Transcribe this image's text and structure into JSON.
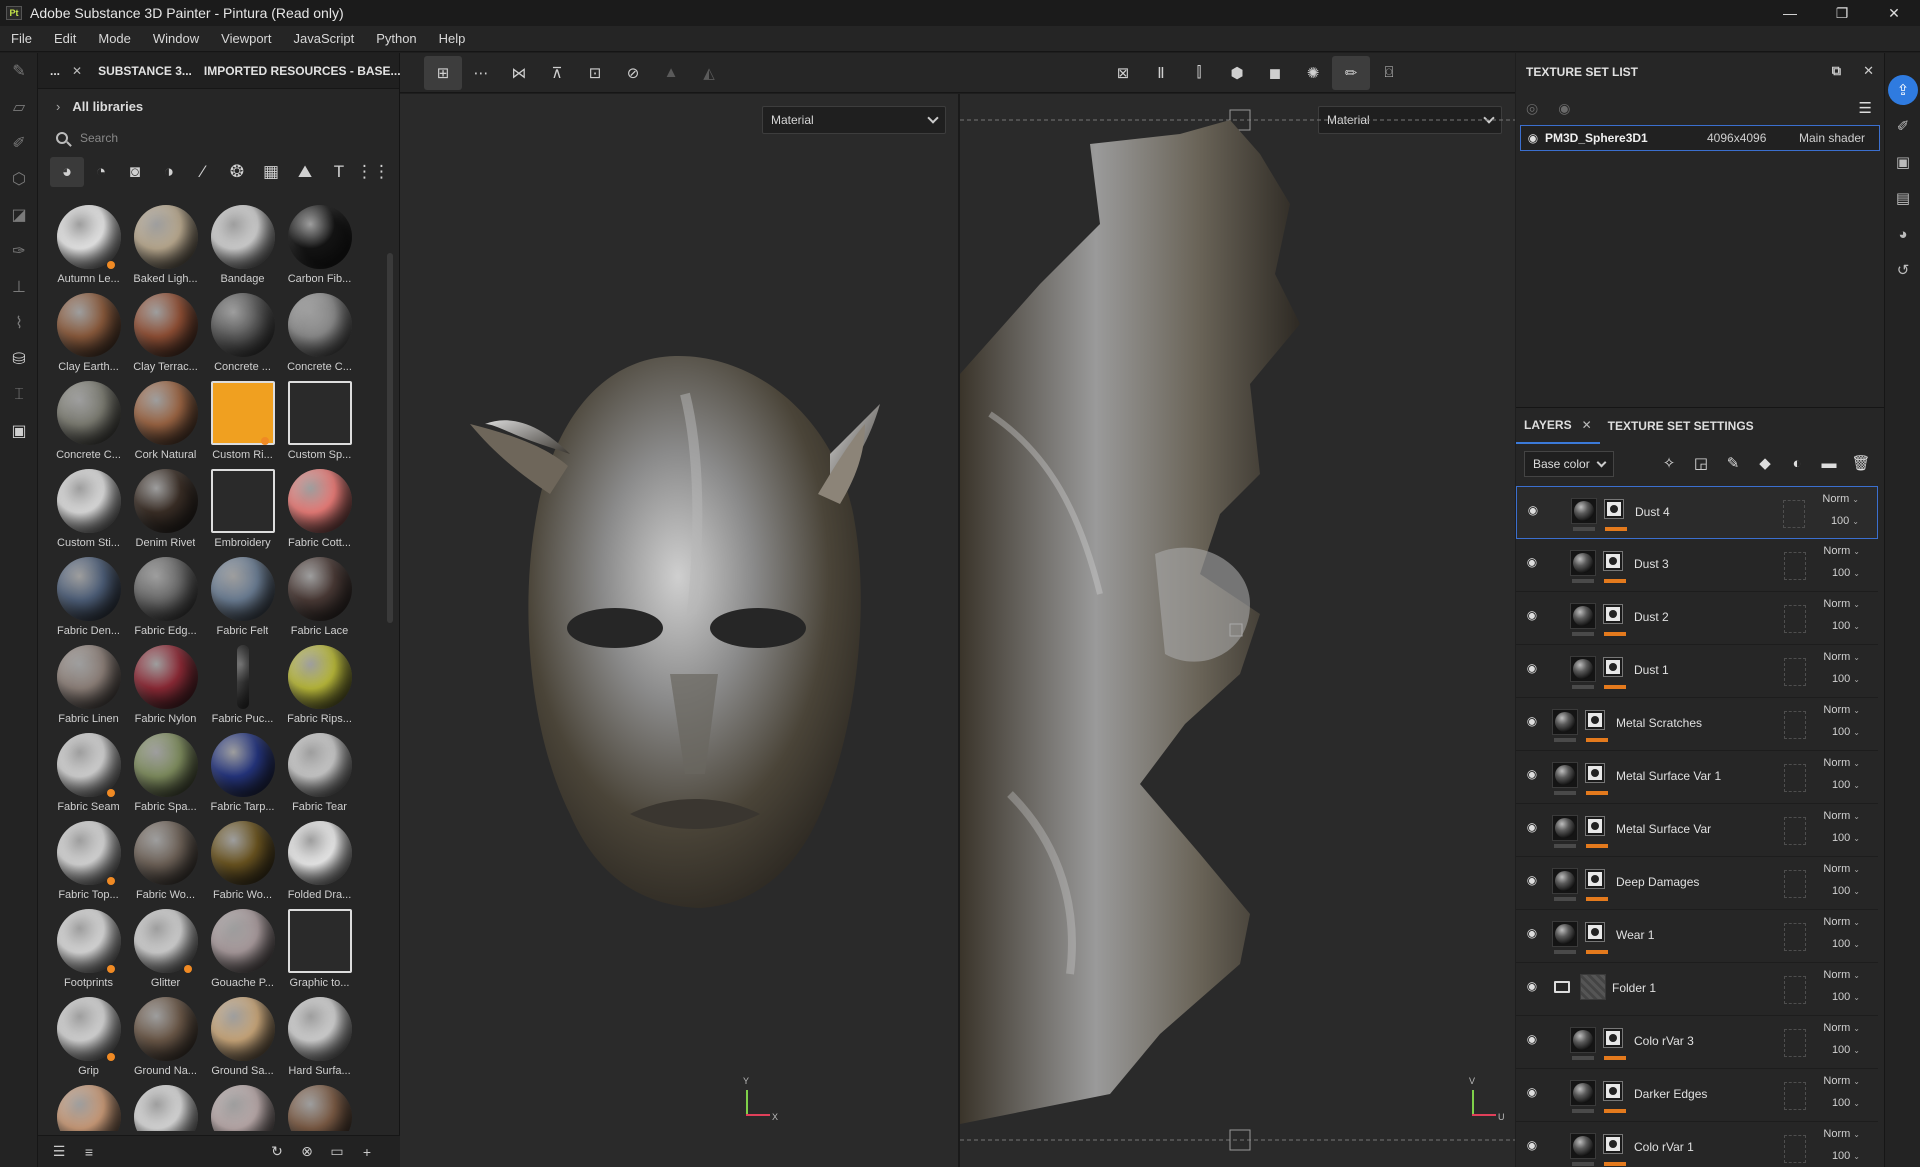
{
  "window": {
    "app_badge": "Pt",
    "title": "Adobe Substance 3D Painter - Pintura (Read only)",
    "controls": [
      "—",
      "❐",
      "✕"
    ]
  },
  "menu": [
    "File",
    "Edit",
    "Mode",
    "Window",
    "Viewport",
    "JavaScript",
    "Python",
    "Help"
  ],
  "assets": {
    "tab_dots": "...",
    "tab_close": "✕",
    "tabs": [
      "SUBSTANCE 3...",
      "IMPORTED RESOURCES - BASE..."
    ],
    "library": "All libraries",
    "search_placeholder": "Search",
    "filter_icons": [
      "material-filter-icon",
      "smart-material-filter-icon",
      "mask-filter-icon",
      "generator-filter-icon",
      "brush-filter-icon",
      "particle-filter-icon",
      "texture-filter-icon",
      "environment-filter-icon",
      "text-filter-icon",
      "all-filter-icon"
    ],
    "items": [
      {
        "name": "Autumn Le...",
        "color": "#e8e8e8",
        "kind": "leaf",
        "badge": true
      },
      {
        "name": "Baked Ligh...",
        "color": "#b9a98f",
        "kind": "ball",
        "badge": false
      },
      {
        "name": "Bandage",
        "color": "#cfcfcf",
        "kind": "ball",
        "badge": false
      },
      {
        "name": "Carbon Fib...",
        "color": "#141414",
        "kind": "ball",
        "badge": false
      },
      {
        "name": "Clay Earth...",
        "color": "#8a5a3c",
        "kind": "ball",
        "badge": false
      },
      {
        "name": "Clay Terrac...",
        "color": "#8f4f35",
        "kind": "ball",
        "badge": false
      },
      {
        "name": "Concrete ...",
        "color": "#5b5b5b",
        "kind": "ball",
        "badge": false
      },
      {
        "name": "Concrete C...",
        "color": "#8a8a8a",
        "kind": "ball",
        "badge": false
      },
      {
        "name": "Concrete C...",
        "color": "#7c7c72",
        "kind": "ball",
        "badge": false
      },
      {
        "name": "Cork Natural",
        "color": "#9a6443",
        "kind": "ball",
        "badge": false
      },
      {
        "name": "Custom Ri...",
        "color": "#f0a020",
        "kind": "square",
        "badge": true
      },
      {
        "name": "Custom Sp...",
        "color": "#2a2a2a",
        "kind": "square",
        "badge": false
      },
      {
        "name": "Custom Sti...",
        "color": "#dcdcdc",
        "kind": "ball",
        "badge": false
      },
      {
        "name": "Denim Rivet",
        "color": "#3a2e26",
        "kind": "ball",
        "badge": false
      },
      {
        "name": "Embroidery",
        "color": "#2a2a2a",
        "kind": "square",
        "badge": false
      },
      {
        "name": "Fabric Cott...",
        "color": "#e87c78",
        "kind": "ball",
        "badge": false
      },
      {
        "name": "Fabric Den...",
        "color": "#4d5e78",
        "kind": "ball",
        "badge": false
      },
      {
        "name": "Fabric Edg...",
        "color": "#6a6a6a",
        "kind": "ball",
        "badge": false
      },
      {
        "name": "Fabric Felt",
        "color": "#6a7c92",
        "kind": "ball",
        "badge": false
      },
      {
        "name": "Fabric Lace",
        "color": "#4a3a36",
        "kind": "ball",
        "badge": false
      },
      {
        "name": "Fabric Linen",
        "color": "#8c7f78",
        "kind": "ball",
        "badge": false
      },
      {
        "name": "Fabric Nylon",
        "color": "#8c2a36",
        "kind": "ball",
        "badge": false
      },
      {
        "name": "Fabric Puc...",
        "color": "#3e3e3e",
        "kind": "stick",
        "badge": false
      },
      {
        "name": "Fabric Rips...",
        "color": "#b8b83a",
        "kind": "ball",
        "badge": false
      },
      {
        "name": "Fabric Seam",
        "color": "#d2d2d2",
        "kind": "ball",
        "badge": true
      },
      {
        "name": "Fabric Spa...",
        "color": "#7e8c5e",
        "kind": "ball",
        "badge": false
      },
      {
        "name": "Fabric Tarp...",
        "color": "#25357e",
        "kind": "ball",
        "badge": false
      },
      {
        "name": "Fabric Tear",
        "color": "#c8c8c8",
        "kind": "ball",
        "badge": false
      },
      {
        "name": "Fabric Top...",
        "color": "#d6d6d6",
        "kind": "ball",
        "badge": true
      },
      {
        "name": "Fabric Wo...",
        "color": "#6e6258",
        "kind": "ball",
        "badge": false
      },
      {
        "name": "Fabric Wo...",
        "color": "#6a5420",
        "kind": "ball",
        "badge": false
      },
      {
        "name": "Folded Dra...",
        "color": "#ececec",
        "kind": "ball",
        "badge": false
      },
      {
        "name": "Footprints",
        "color": "#d8d8d8",
        "kind": "ball",
        "badge": true
      },
      {
        "name": "Glitter",
        "color": "#cfcfcf",
        "kind": "ball",
        "badge": true
      },
      {
        "name": "Gouache P...",
        "color": "#a89a9c",
        "kind": "ball",
        "badge": false
      },
      {
        "name": "Graphic to...",
        "color": "#2a2a2a",
        "kind": "square",
        "badge": false
      },
      {
        "name": "Grip",
        "color": "#d4d4d4",
        "kind": "ball",
        "badge": true
      },
      {
        "name": "Ground Na...",
        "color": "#6b5848",
        "kind": "ball",
        "badge": false
      },
      {
        "name": "Ground Sa...",
        "color": "#c8a67a",
        "kind": "ball",
        "badge": false
      },
      {
        "name": "Hard Surfa...",
        "color": "#d0d0d0",
        "kind": "ball",
        "badge": false
      },
      {
        "name": "",
        "color": "#c99a78",
        "kind": "ball",
        "badge": false
      },
      {
        "name": "",
        "color": "#d8d8d8",
        "kind": "ball",
        "badge": false
      },
      {
        "name": "",
        "color": "#b8a8a8",
        "kind": "ball",
        "badge": false
      },
      {
        "name": "",
        "color": "#7a5a44",
        "kind": "ball",
        "badge": false
      }
    ],
    "bottom_icons": [
      "filter-list-icon",
      "sort-icon",
      "refresh-icon",
      "reset-icon",
      "folder-icon",
      "add-icon"
    ]
  },
  "viewport": {
    "left_dropdown": "Material",
    "right_dropdown": "Material",
    "axis_y": "Y",
    "axis_x": "X",
    "axis_u": "U",
    "axis_v": "V"
  },
  "texture_set_list": {
    "title": "TEXTURE SET LIST",
    "row": {
      "name": "PM3D_Sphere3D1",
      "resolution": "4096x4096",
      "shader": "Main shader"
    }
  },
  "layers": {
    "tab_layers": "LAYERS",
    "tab_close": "✕",
    "tab_settings": "TEXTURE SET SETTINGS",
    "channel": "Base color",
    "items": [
      {
        "name": "Dust 4",
        "blend": "Norm",
        "opacity": "100",
        "indent": true,
        "folder": false,
        "selected": true
      },
      {
        "name": "Dust 3",
        "blend": "Norm",
        "opacity": "100",
        "indent": true,
        "folder": false,
        "selected": false
      },
      {
        "name": "Dust 2",
        "blend": "Norm",
        "opacity": "100",
        "indent": true,
        "folder": false,
        "selected": false
      },
      {
        "name": "Dust 1",
        "blend": "Norm",
        "opacity": "100",
        "indent": true,
        "folder": false,
        "selected": false
      },
      {
        "name": "Metal Scratches",
        "blend": "Norm",
        "opacity": "100",
        "indent": false,
        "folder": false,
        "selected": false
      },
      {
        "name": "Metal Surface Var 1",
        "blend": "Norm",
        "opacity": "100",
        "indent": false,
        "folder": false,
        "selected": false
      },
      {
        "name": "Metal Surface Var",
        "blend": "Norm",
        "opacity": "100",
        "indent": false,
        "folder": false,
        "selected": false
      },
      {
        "name": "Deep Damages",
        "blend": "Norm",
        "opacity": "100",
        "indent": false,
        "folder": false,
        "selected": false
      },
      {
        "name": "Wear 1",
        "blend": "Norm",
        "opacity": "100",
        "indent": false,
        "folder": false,
        "selected": false
      },
      {
        "name": "Folder 1",
        "blend": "Norm",
        "opacity": "100",
        "indent": false,
        "folder": true,
        "selected": false
      },
      {
        "name": "Colo rVar 3",
        "blend": "Norm",
        "opacity": "100",
        "indent": true,
        "folder": false,
        "selected": false
      },
      {
        "name": "Darker Edges",
        "blend": "Norm",
        "opacity": "100",
        "indent": true,
        "folder": false,
        "selected": false
      },
      {
        "name": "Colo rVar 1",
        "blend": "Norm",
        "opacity": "100",
        "indent": true,
        "folder": false,
        "selected": false
      }
    ]
  },
  "colors": {
    "accent": "#2f7be0",
    "orange": "#e47a1d"
  }
}
